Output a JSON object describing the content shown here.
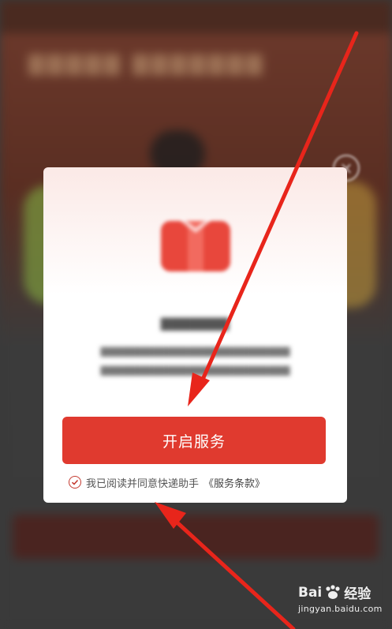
{
  "modal": {
    "primary_button_label": "开启服务",
    "agreement_text": "我已阅读并同意快递助手",
    "terms_link": "《服务条款》",
    "close_symbol": "×",
    "icon": "gift-box-icon"
  },
  "watermark": {
    "logo_text": "Bai",
    "logo_text_suffix": "经验",
    "url": "jingyan.baidu.com"
  },
  "colors": {
    "accent": "#e03a2f",
    "arrow": "#e8251b"
  }
}
